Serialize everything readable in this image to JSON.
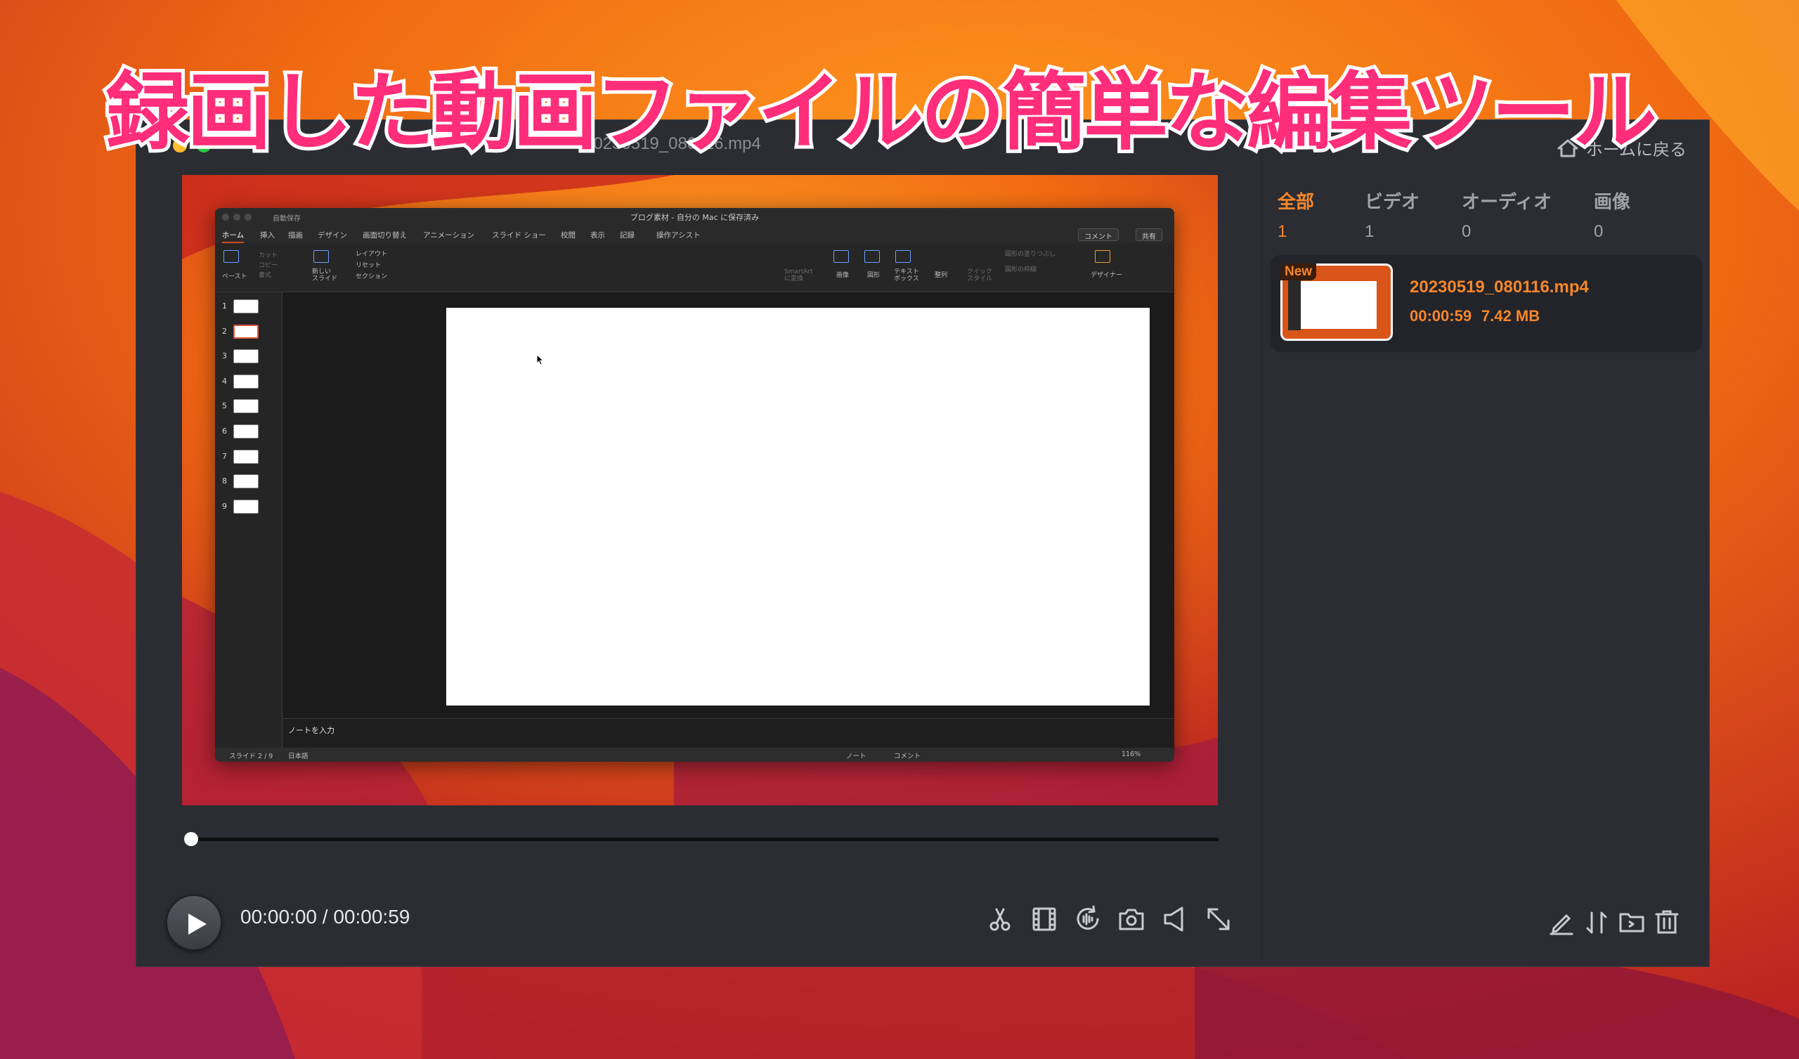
{
  "banner": {
    "text": "録画した動画ファイルの簡単な編集ツール"
  },
  "window": {
    "title": "20230519_080116.mp4",
    "home_button_label": "ホームに戻る"
  },
  "video_content": {
    "autosave_label": "自動保存",
    "doc_title": "ブログ素材 - 自分の Mac に保存済み",
    "tabs": [
      "ホーム",
      "挿入",
      "描画",
      "デザイン",
      "画面切り替え",
      "アニメーション",
      "スライド ショー",
      "校閲",
      "表示",
      "記録",
      "操作アシスト"
    ],
    "comment_button": "コメント",
    "share_button": "共有",
    "ribbon": {
      "paste": "ペースト",
      "cut": "カット",
      "copy": "コピー",
      "format": "書式",
      "new_slide": "新しい\nスライド",
      "layout": "レイアウト",
      "reset": "リセット",
      "section": "セクション",
      "smartart": "SmartArt\nに変換",
      "picture": "画像",
      "shapes": "図形",
      "textbox": "テキスト\nボックス",
      "arrange": "整列",
      "quick_styles": "クイック\nスタイル",
      "shape_fill": "図形の塗りつぶし",
      "shape_outline": "図形の枠線",
      "designer": "デザイナー"
    },
    "slide_numbers": [
      "1",
      "2",
      "3",
      "4",
      "5",
      "6",
      "7",
      "8",
      "9"
    ],
    "active_slide_index": 1,
    "notes_placeholder": "ノートを入力",
    "status": {
      "slide_counter": "スライド 2 / 9",
      "language": "日本語",
      "notes": "ノート",
      "comments": "コメント",
      "zoom": "116%"
    }
  },
  "player": {
    "progress_fraction": 0.0,
    "current_time": "00:00:00",
    "separator": "/",
    "total_time": "00:00:59",
    "tools": [
      "scissors-icon",
      "film-trim-icon",
      "audio-effect-icon",
      "camera-icon",
      "volume-icon",
      "expand-icon"
    ]
  },
  "library": {
    "filters": [
      {
        "label": "全部",
        "count": "1",
        "active": true
      },
      {
        "label": "ビデオ",
        "count": "1",
        "active": false
      },
      {
        "label": "オーディオ",
        "count": "0",
        "active": false
      },
      {
        "label": "画像",
        "count": "0",
        "active": false
      }
    ],
    "files": [
      {
        "badge": "New",
        "name": "20230519_080116.mp4",
        "duration": "00:00:59",
        "size": "7.42 MB"
      }
    ],
    "actions": [
      "edit-icon",
      "sort-icon",
      "open-folder-icon",
      "trash-icon"
    ]
  },
  "colors": {
    "accent": "#f5862b",
    "window_bg": "#2b2d33",
    "banner_text": "#ff2d7a"
  }
}
